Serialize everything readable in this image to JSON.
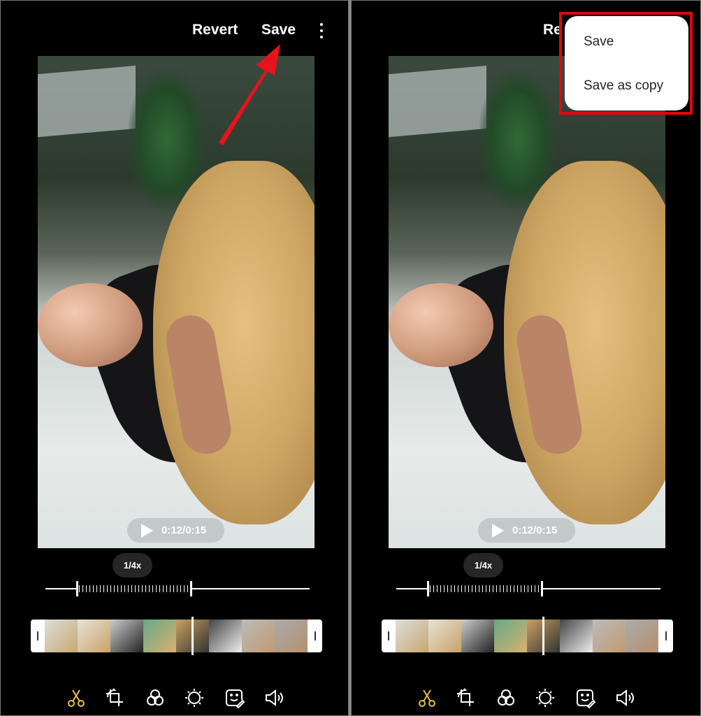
{
  "toolbar": {
    "revert_label": "Revert",
    "save_label": "Save",
    "more_icon": "more-vert-icon"
  },
  "video": {
    "time": "0:12/0:15",
    "speed": "1/4x"
  },
  "tools": [
    "scissors-icon",
    "crop-rotate-icon",
    "filters-icon",
    "brightness-icon",
    "sticker-icon",
    "volume-icon"
  ],
  "active_tool_color": "#e8c341",
  "menu": {
    "items": [
      {
        "label": "Save"
      },
      {
        "label": "Save as copy"
      }
    ]
  },
  "annotation": {
    "arrow_color": "#e8121c",
    "highlight_color": "#e0060e"
  },
  "panels": {
    "left": {
      "revert": "Revert",
      "save": "Save"
    },
    "right": {
      "revert": "Re"
    }
  }
}
